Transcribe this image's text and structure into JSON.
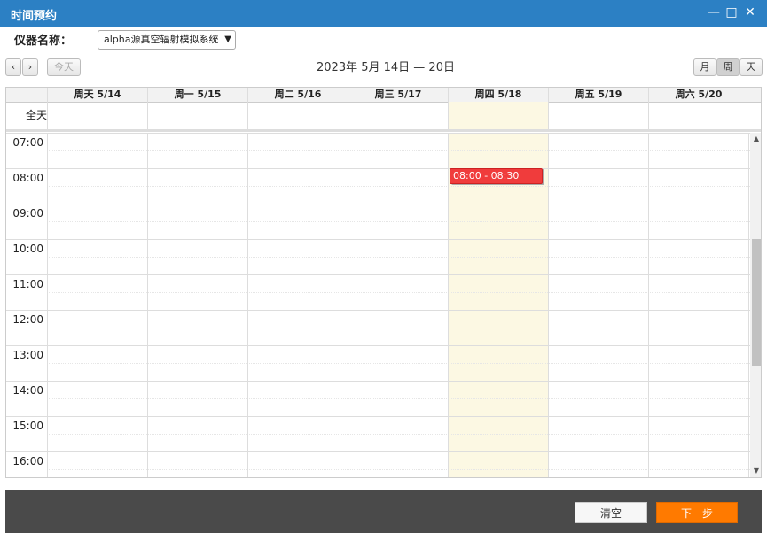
{
  "window": {
    "title": "时间预约",
    "minimize": "—",
    "maximize": "□",
    "close": "✕"
  },
  "instrument": {
    "label": "仪器名称：",
    "selected": "alpha源真空辐射模拟系统"
  },
  "nav": {
    "prev": "‹",
    "next": "›",
    "today": "今天",
    "range": "2023年 5月 14日 — 20日",
    "views": [
      "月",
      "周",
      "天"
    ],
    "active_view": "周"
  },
  "columns": [
    "周天 5/14",
    "周一 5/15",
    "周二 5/16",
    "周三 5/17",
    "周四 5/18",
    "周五 5/19",
    "周六 5/20"
  ],
  "today_index": 4,
  "allday_label": "全天",
  "hours": [
    "07:00",
    "08:00",
    "09:00",
    "10:00",
    "11:00",
    "12:00",
    "13:00",
    "14:00",
    "15:00",
    "16:00"
  ],
  "events": [
    {
      "day_index": 4,
      "start": 8.0,
      "end": 8.5,
      "label": "08:00 - 08:30",
      "color": "#f03c3c"
    }
  ],
  "footer": {
    "clear": "清空",
    "next": "下一步"
  }
}
